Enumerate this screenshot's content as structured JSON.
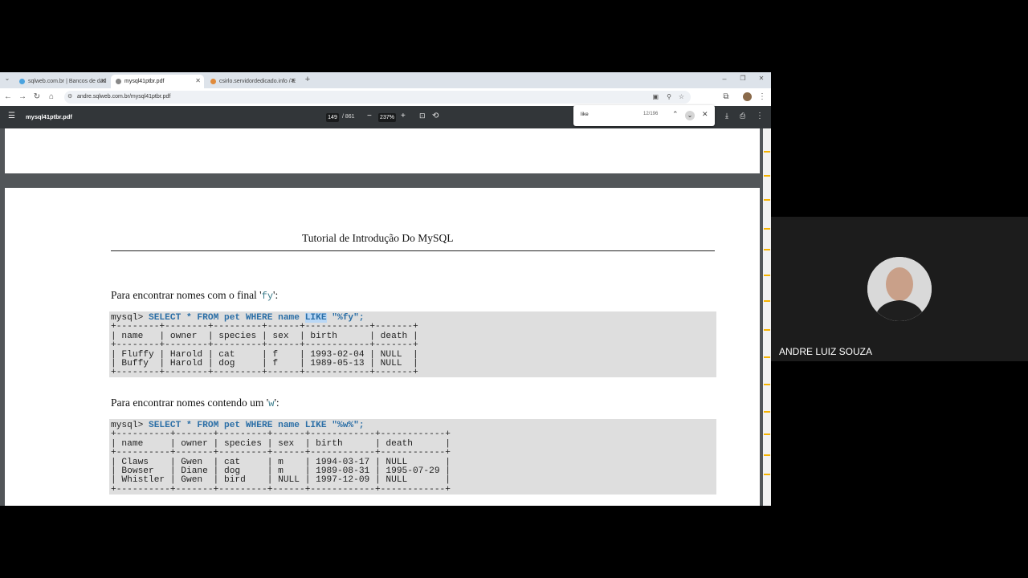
{
  "browser": {
    "tabs": [
      {
        "title": "sqlweb.com.br | Bancos de dad",
        "active": false
      },
      {
        "title": "mysql41ptbr.pdf",
        "active": true
      },
      {
        "title": "csirlo.servidordedicado.info / E",
        "active": false
      }
    ],
    "url": "andre.sqlweb.com.br/mysql41ptbr.pdf"
  },
  "pdf_toolbar": {
    "filename": "mysql41ptbr.pdf",
    "page_current": "149",
    "page_total": "/ 861",
    "zoom": "237%"
  },
  "find": {
    "query": "like",
    "count": "12/196"
  },
  "document": {
    "title": "Tutorial de Introdução Do MySQL",
    "section1": {
      "text_before": "Para encontrar nomes com o final '",
      "code": "fy",
      "text_after": "':",
      "query_prompt": "mysql> ",
      "query_kw1": "SELECT * FROM pet WHERE name ",
      "query_hl": "LIKE",
      "query_rest": " \"%fy\";",
      "table_lines": [
        "+--------+--------+---------+------+------------+-------+",
        "| name   | owner  | species | sex  | birth      | death |",
        "+--------+--------+---------+------+------------+-------+",
        "| Fluffy | Harold | cat     | f    | 1993-02-04 | NULL  |",
        "| Buffy  | Harold | dog     | f    | 1989-05-13 | NULL  |",
        "+--------+--------+---------+------+------------+-------+"
      ]
    },
    "section2": {
      "text_before": "Para encontrar nomes contendo um '",
      "code": "w",
      "text_after": "':",
      "query_prompt": "mysql> ",
      "query_kw": "SELECT * FROM pet WHERE name LIKE \"%w%\";",
      "table_lines": [
        "+----------+-------+---------+------+------------+------------+",
        "| name     | owner | species | sex  | birth      | death      |",
        "+----------+-------+---------+------+------------+------------+",
        "| Claws    | Gwen  | cat     | m    | 1994-03-17 | NULL       |",
        "| Bowser   | Diane | dog     | m    | 1989-08-31 | 1995-07-29 |",
        "| Whistler | Gwen  | bird    | NULL | 1997-12-09 | NULL       |",
        "+----------+-------+---------+------+------------+------------+"
      ]
    }
  },
  "video": {
    "participant_name": "ANDRE LUIZ SOUZA"
  },
  "colors": {
    "pdf_toolbar": "#323639",
    "viewer_bg": "#525659",
    "search_highlight": "#f6b400",
    "code_bg": "#dedede"
  }
}
